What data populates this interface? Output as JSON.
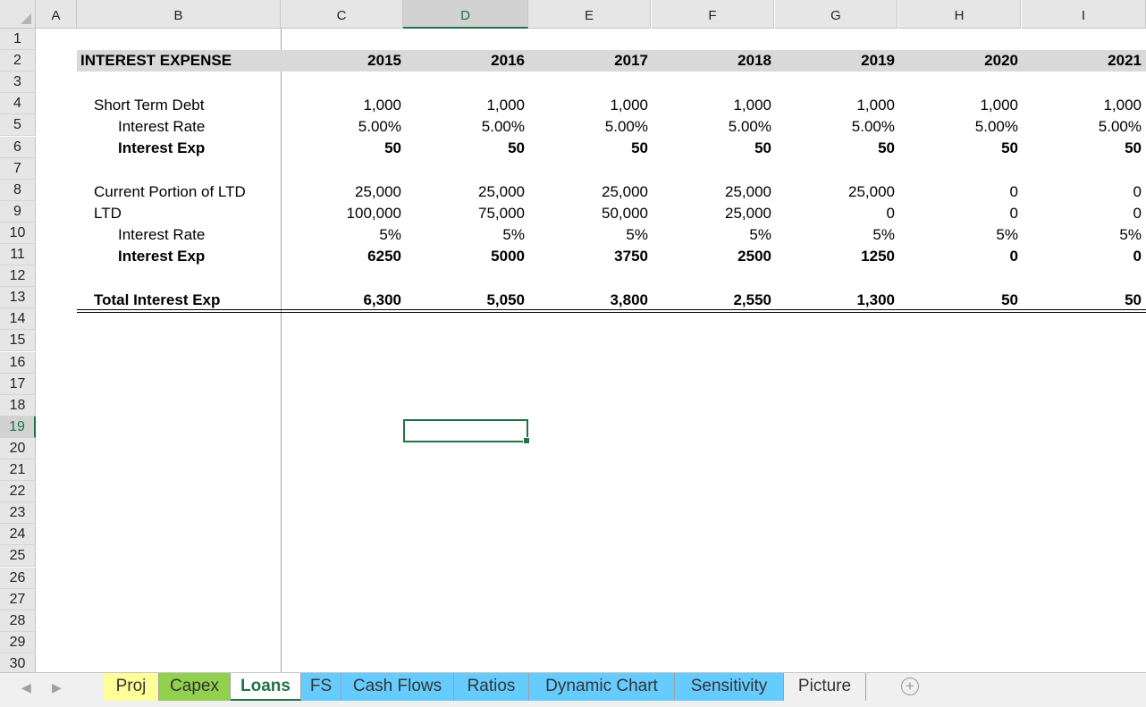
{
  "columns": [
    "A",
    "B",
    "C",
    "D",
    "E",
    "F",
    "G",
    "H",
    "I"
  ],
  "row_numbers": [
    "1",
    "2",
    "3",
    "4",
    "5",
    "6",
    "7",
    "8",
    "9",
    "10",
    "11",
    "12",
    "13",
    "14",
    "15",
    "16",
    "17",
    "18",
    "19",
    "20",
    "21",
    "22",
    "23",
    "24",
    "25",
    "26",
    "27",
    "28",
    "29",
    "30"
  ],
  "header": {
    "title": "INTEREST EXPENSE",
    "years": [
      "2015",
      "2016",
      "2017",
      "2018",
      "2019",
      "2020",
      "2021"
    ]
  },
  "short_term": {
    "label": "Short Term Debt",
    "values": [
      "1,000",
      "1,000",
      "1,000",
      "1,000",
      "1,000",
      "1,000",
      "1,000"
    ],
    "rate_label": "Interest Rate",
    "rates": [
      "5.00%",
      "5.00%",
      "5.00%",
      "5.00%",
      "5.00%",
      "5.00%",
      "5.00%"
    ],
    "exp_label": "Interest Exp",
    "exps": [
      "50",
      "50",
      "50",
      "50",
      "50",
      "50",
      "50"
    ]
  },
  "long_term": {
    "current_label": "Current Portion of LTD",
    "current": [
      "25,000",
      "25,000",
      "25,000",
      "25,000",
      "25,000",
      "0",
      "0"
    ],
    "ltd_label": "LTD",
    "ltd": [
      "100,000",
      "75,000",
      "50,000",
      "25,000",
      "0",
      "0",
      "0"
    ],
    "rate_label": "Interest Rate",
    "rates": [
      "5%",
      "5%",
      "5%",
      "5%",
      "5%",
      "5%",
      "5%"
    ],
    "exp_label": "Interest Exp",
    "exps": [
      "6250",
      "5000",
      "3750",
      "2500",
      "1250",
      "0",
      "0"
    ]
  },
  "total": {
    "label": "Total Interest Exp",
    "values": [
      "6,300",
      "5,050",
      "3,800",
      "2,550",
      "1,300",
      "50",
      "50"
    ]
  },
  "selection": {
    "cell": "D19"
  },
  "tabs": [
    {
      "label": "Proj",
      "color": "#ffff99"
    },
    {
      "label": "Capex",
      "color": "#92d050"
    },
    {
      "label": "Loans",
      "color": "#ffffff"
    },
    {
      "label": "FS",
      "color": "#66ccff"
    },
    {
      "label": "Cash Flows",
      "color": "#66ccff"
    },
    {
      "label": "Ratios",
      "color": "#66ccff"
    },
    {
      "label": "Dynamic Chart",
      "color": "#66ccff"
    },
    {
      "label": "Sensitivity",
      "color": "#66ccff"
    },
    {
      "label": "Picture",
      "color": "#f0f0f0"
    }
  ],
  "active_tab": "Loans",
  "accent_color": "#217346"
}
